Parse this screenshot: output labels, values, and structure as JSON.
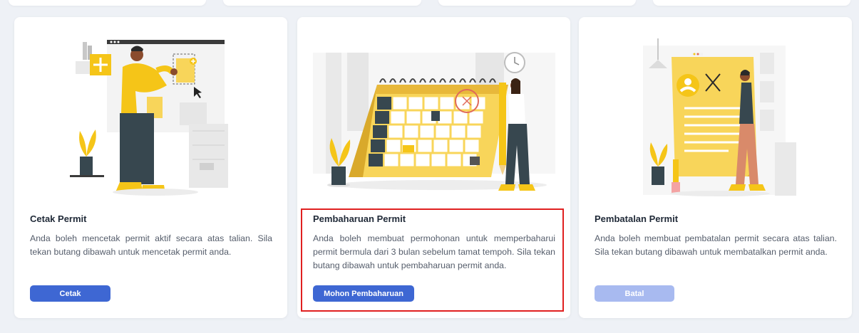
{
  "cards": [
    {
      "title": "Cetak Permit",
      "description": "Anda boleh mencetak permit aktif secara atas talian. Sila tekan butang dibawah untuk mencetak permit anda.",
      "button_label": "Cetak",
      "button_state": "enabled"
    },
    {
      "title": "Pembaharuan Permit",
      "description": "Anda boleh membuat permohonan untuk memperbaharui permit bermula dari 3 bulan sebelum tamat tempoh. Sila tekan butang dibawah untuk pembaharuan permit anda.",
      "button_label": "Mohon Pembaharuan",
      "button_state": "enabled",
      "highlighted": true
    },
    {
      "title": "Pembatalan Permit",
      "description": "Anda boleh membuat pembatalan permit secara atas talian. Sila tekan butang dibawah untuk membatalkan permit anda.",
      "button_label": "Batal",
      "button_state": "disabled"
    }
  ],
  "colors": {
    "background": "#eef1f6",
    "card": "#ffffff",
    "primary_button": "#3e67d3",
    "disabled_button": "#a8baf0",
    "accent_yellow": "#f5c518",
    "highlight_border": "#e02020"
  },
  "illustrations": [
    "print-document-illustration",
    "calendar-renewal-illustration",
    "cancel-document-illustration"
  ]
}
